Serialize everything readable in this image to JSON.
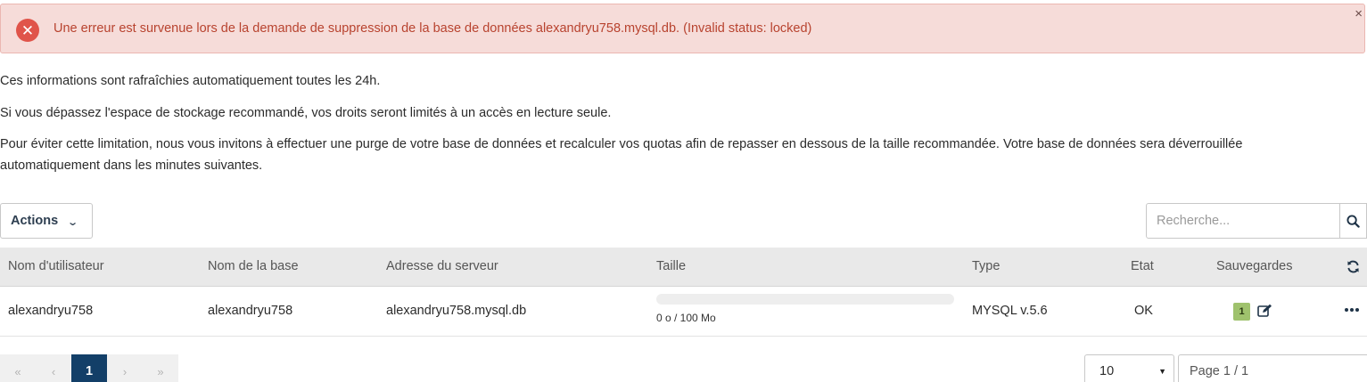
{
  "alert": {
    "message": "Une erreur est survenue lors de la demande de suppression de la base de données alexandryu758.mysql.db. (Invalid status: locked)",
    "icon": "error-circle-icon",
    "close_label": "×"
  },
  "info": {
    "line1": "Ces informations sont rafraîchies automatiquement toutes les 24h.",
    "line2": "Si vous dépassez l'espace de stockage recommandé, vos droits seront limités à un accès en lecture seule.",
    "line3": "Pour éviter cette limitation, nous vous invitons à effectuer une purge de votre base de données et recalculer vos quotas afin de repasser en dessous de la taille recommandée. Votre base de données sera déverrouillée automatiquement dans les minutes suivantes."
  },
  "toolbar": {
    "actions_label": "Actions",
    "search_placeholder": "Recherche..."
  },
  "table": {
    "headers": {
      "user": "Nom d'utilisateur",
      "base": "Nom de la base",
      "server": "Adresse du serveur",
      "size": "Taille",
      "type": "Type",
      "state": "Etat",
      "backups": "Sauvegardes"
    },
    "rows": [
      {
        "user": "alexandryu758",
        "base": "alexandryu758",
        "server": "alexandryu758.mysql.db",
        "size_text": "0 o / 100 Mo",
        "size_fraction": 0,
        "type": "MYSQL v.5.6",
        "state": "OK",
        "backups_count": "1"
      }
    ]
  },
  "pagination": {
    "first": "«",
    "prev": "‹",
    "current": "1",
    "next": "›",
    "last": "»",
    "per_page": "10",
    "page_info": "Page 1 / 1"
  },
  "colors": {
    "alert_bg": "#f6dcd9",
    "alert_text": "#b8432f",
    "active_page": "#133f68",
    "badge": "#9fc26d"
  }
}
